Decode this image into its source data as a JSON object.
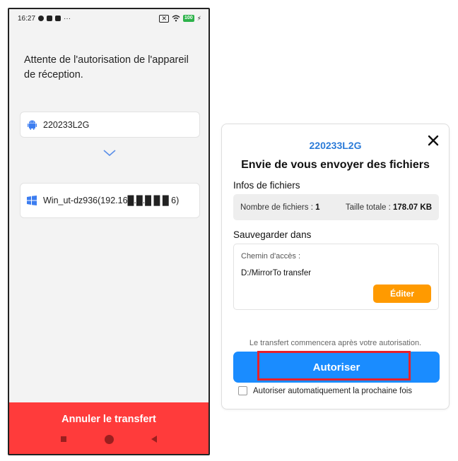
{
  "phone": {
    "status_time": "16:27",
    "status_more": "···",
    "status_battery": "100",
    "waiting_text": "Attente de l'autorisation de l'appareil de réception.",
    "source_device": "220233L2G",
    "source_icon": "android-icon",
    "target_device": "Win_ut-dz936(192.16█.█.█ █ █ 6)",
    "target_icon": "windows-icon",
    "cancel_label": "Annuler le transfert"
  },
  "dialog": {
    "device_name": "220233L2G",
    "heading": "Envie de vous envoyer des fichiers",
    "files_section": "Infos de fichiers",
    "file_count_label": "Nombre de fichiers : ",
    "file_count_value": "1",
    "total_size_label": "Taille totale : ",
    "total_size_value": "178.07 KB",
    "save_section": "Sauvegarder dans",
    "path_label": "Chemin d'accès :",
    "path_value": "D:/MirrorTo transfer",
    "edit_label": "Éditer",
    "note": "Le transfert commencera après votre autorisation.",
    "authorize_label": "Autoriser",
    "auto_authorize_label": "Autoriser automatiquement la prochaine fois"
  },
  "colors": {
    "accent_blue": "#1a8cff",
    "device_blue": "#2b7bd8",
    "edit_orange": "#ff9a00",
    "cancel_red": "#ff3b3b",
    "highlight_red": "#e8202a"
  }
}
